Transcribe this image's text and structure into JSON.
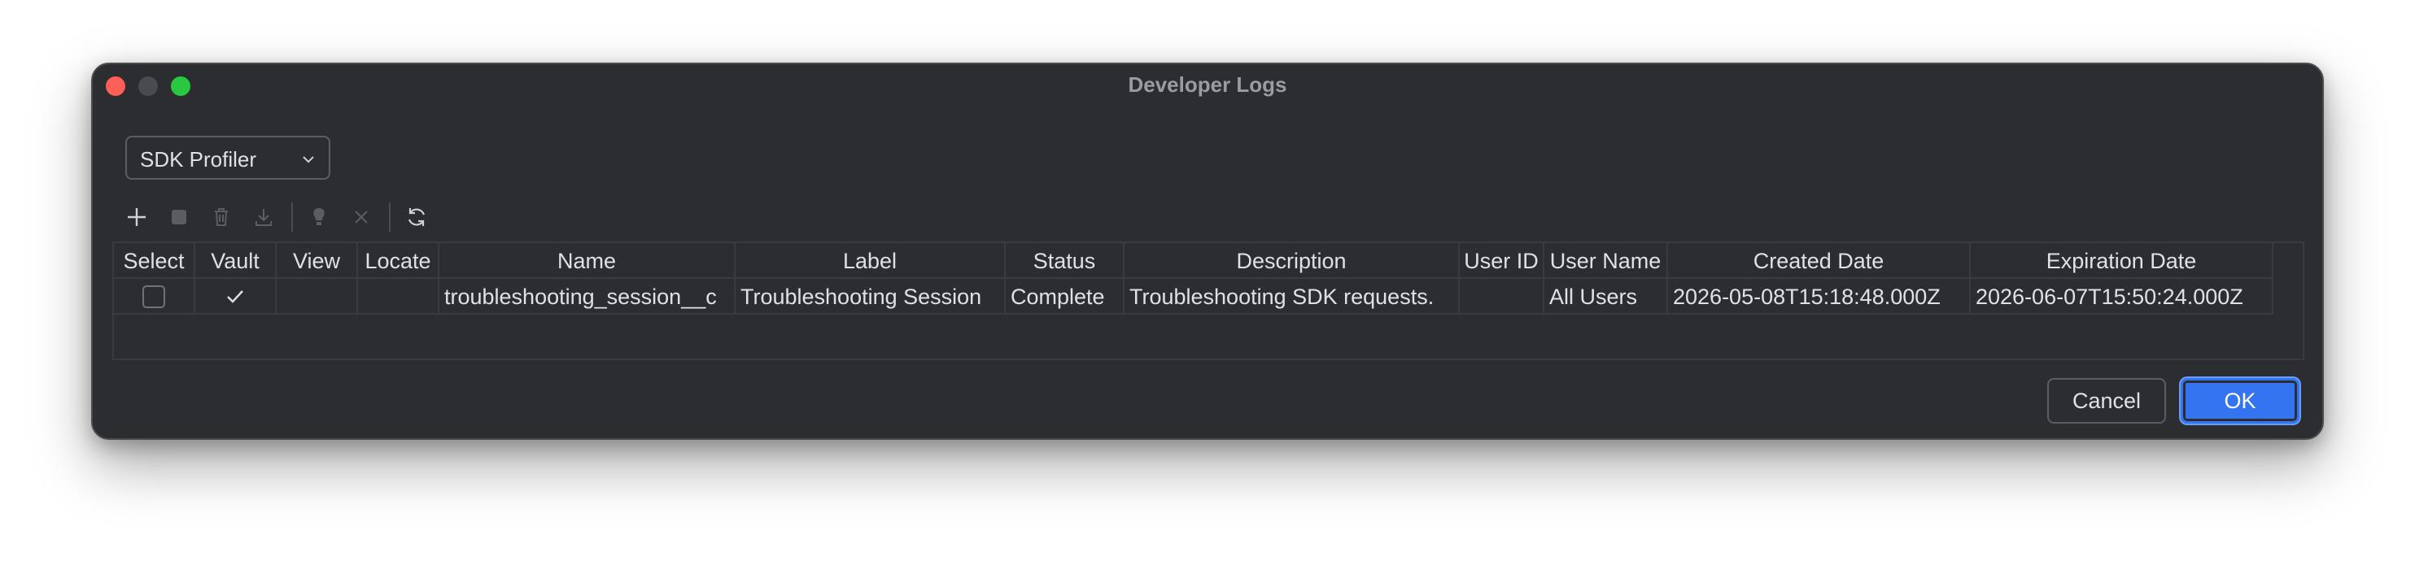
{
  "window": {
    "title": "Developer Logs"
  },
  "dropdown": {
    "selected": "SDK Profiler"
  },
  "toolbar": {
    "icons": [
      "add-icon",
      "stop-icon",
      "delete-icon",
      "download-icon",
      "lightbulb-icon",
      "close-icon",
      "refresh-icon"
    ]
  },
  "table": {
    "columns": [
      "Select",
      "Vault",
      "View",
      "Locate",
      "Name",
      "Label",
      "Status",
      "Description",
      "User ID",
      "User Name",
      "Created Date",
      "Expiration Date"
    ],
    "rows": [
      {
        "select": false,
        "vault": true,
        "view": "",
        "locate": "",
        "name": "troubleshooting_session__c",
        "label": "Troubleshooting Session",
        "status": "Complete",
        "description": "Troubleshooting SDK requests.",
        "user_id": "",
        "user_name": "All Users",
        "created_date": "2026-05-08T15:18:48.000Z",
        "expiration_date": "2026-06-07T15:50:24.000Z"
      }
    ]
  },
  "buttons": {
    "cancel": "Cancel",
    "ok": "OK"
  },
  "colors": {
    "window_bg": "#2b2d30",
    "accent": "#3574f0",
    "close": "#ff5f57",
    "maximize": "#28c840"
  }
}
